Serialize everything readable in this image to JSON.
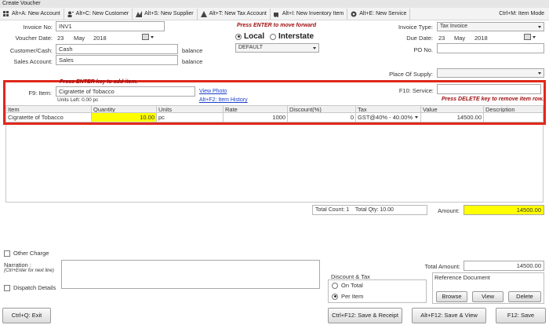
{
  "window": {
    "title": "Create Voucher"
  },
  "toolbar": {
    "items": [
      {
        "label": "Alt+A: New Account",
        "icon": "grid-icon"
      },
      {
        "label": "Alt+C: New Customer",
        "icon": "person-add-icon"
      },
      {
        "label": "Alt+S: New Supplier",
        "icon": "supplier-icon"
      },
      {
        "label": "Alt+T: New Tax Account",
        "icon": "tax-account-icon"
      },
      {
        "label": "Alt+I: New Inventory Item",
        "icon": "inventory-icon"
      },
      {
        "label": "Alt+E: New Service",
        "icon": "service-icon"
      }
    ],
    "right_label": "Ctrl+M: Item Mode"
  },
  "header": {
    "invoice_no_label": "Invoice No:",
    "invoice_no": "INV1",
    "voucher_date_label": "Voucher Date:",
    "voucher_day": "23",
    "voucher_month": "May",
    "voucher_year": "2018",
    "customer_label": "Customer/Cash:",
    "customer": "Cash",
    "customer_balance": "balance",
    "sales_account_label": "Sales Account:",
    "sales_account": "Sales",
    "sales_balance": "balance",
    "enter_hint": "Press ENTER to move forward",
    "local_label": "Local",
    "interstate_label": "Interstate",
    "price_list": "DEFAULT",
    "invoice_type_label": "Invoice Type:",
    "invoice_type": "Tax Invoice",
    "due_date_label": "Due Date:",
    "due_day": "23",
    "due_month": "May",
    "due_year": "2018",
    "po_label": "PO No.",
    "po_value": "",
    "place_of_supply_label": "Place Of Supply:",
    "place_of_supply": ""
  },
  "item_entry": {
    "hint": "Press ENTER key to add item.",
    "item_label": "F9: Item:",
    "item_value": "Cigratette of Tobacco",
    "units_left": "Units Left: 0.00 pc",
    "view_photo": "View Photo",
    "item_history": "Alt+F2: Item History",
    "service_label": "F10: Service:",
    "service_value": "",
    "delete_hint": "Press DELETE key to remove item row."
  },
  "grid": {
    "columns": [
      "Item",
      "Quantity",
      "Units",
      "Rate",
      "Discount(%)",
      "Tax",
      "Value",
      "Description"
    ],
    "rows": [
      {
        "item": "Cigratette of Tobacco",
        "quantity": "10.00",
        "units": "pc",
        "rate": "1000",
        "discount": "0",
        "tax": "GST@40% - 40.00%",
        "value": "14500.00",
        "description": ""
      }
    ]
  },
  "totals": {
    "count_label": "Total Count: 1",
    "qty_label": "Total Qty: 10.00",
    "amount_label": "Amount:",
    "amount": "14500.00",
    "total_amount_label": "Total Amount:",
    "total_amount": "14500.00"
  },
  "footer": {
    "other_charge": "Other Charge",
    "narration_label": "Narration :",
    "narration_hint": "(Ctrl+Enter for next line)",
    "narration_value": "",
    "dispatch_details": "Dispatch Details",
    "discount_tax_title": "Discount & Tax",
    "on_total": "On Total",
    "per_item": "Per Item",
    "ref_doc_title": "Reference Document",
    "browse": "Browse",
    "view": "View",
    "delete": "Delete",
    "exit_btn": "Ctrl+Q: Exit",
    "save_receipt_btn": "Ctrl+F12: Save & Receipt",
    "save_view_btn": "Alt+F12: Save & View",
    "save_btn": "F12: Save"
  },
  "colors": {
    "highlight": "#ffff00",
    "red_border": "#e0281c",
    "hint_red": "#a01010",
    "link_blue": "#1a3fcc"
  }
}
